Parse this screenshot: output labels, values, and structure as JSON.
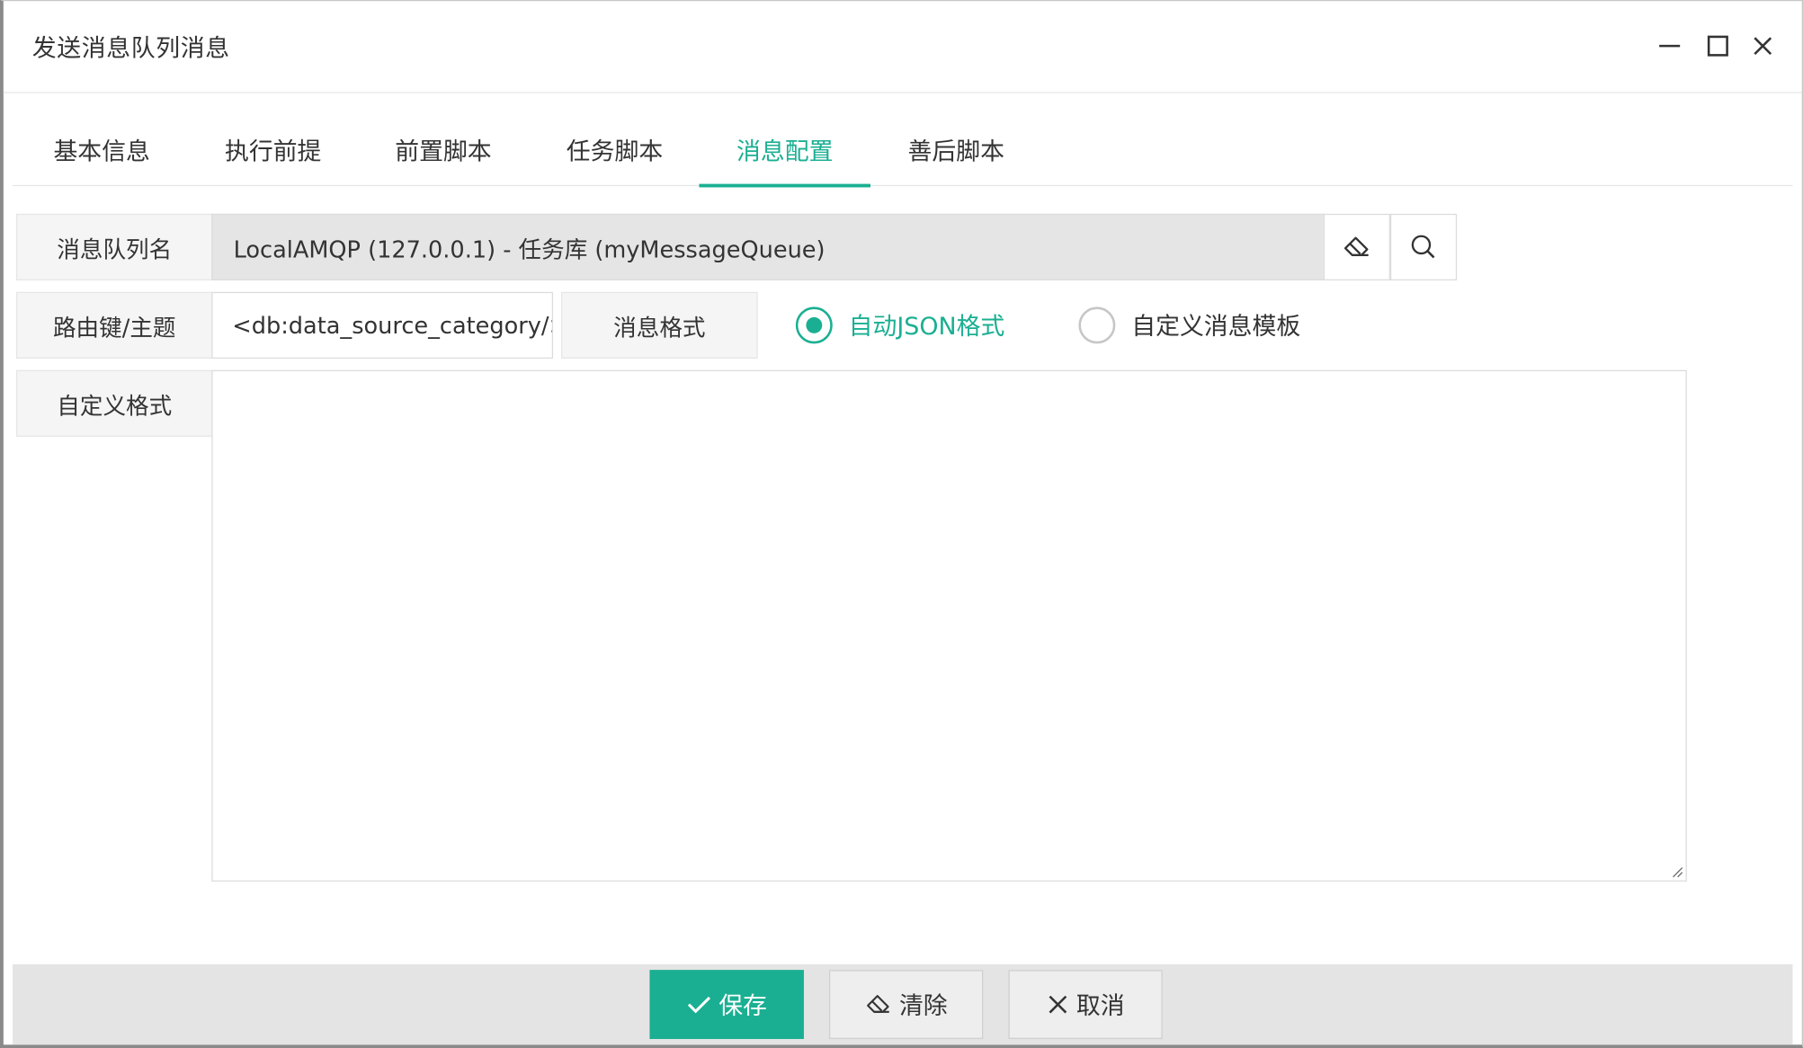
{
  "window": {
    "title": "发送消息队列消息",
    "controls": [
      "minimize-icon",
      "maximize-icon",
      "close-icon"
    ]
  },
  "tabs": [
    {
      "label": "基本信息",
      "active": false
    },
    {
      "label": "执行前提",
      "active": false
    },
    {
      "label": "前置脚本",
      "active": false
    },
    {
      "label": "任务脚本",
      "active": false
    },
    {
      "label": "消息配置",
      "active": true
    },
    {
      "label": "善后脚本",
      "active": false
    }
  ],
  "form": {
    "queue_name": {
      "label": "消息队列名",
      "value": "LocalAMQP (127.0.0.1) - 任务库 (myMessageQueue)",
      "clear_icon": "eraser-icon",
      "search_icon": "search-icon"
    },
    "routing_key": {
      "label": "路由键/主题",
      "value": "<db:data_source_category/>"
    },
    "message_format": {
      "label": "消息格式",
      "options": [
        {
          "label": "自动JSON格式",
          "checked": true
        },
        {
          "label": "自定义消息模板",
          "checked": false
        }
      ]
    },
    "custom_format": {
      "label": "自定义格式",
      "value": ""
    }
  },
  "footer": {
    "save_label": "保存",
    "clear_label": "清除",
    "cancel_label": "取消"
  },
  "colors": {
    "accent": "#1aaf92",
    "label_bg": "#f5f5f5",
    "readonly_bg": "#e5e5e5",
    "footer_bg": "#e4e4e4"
  }
}
